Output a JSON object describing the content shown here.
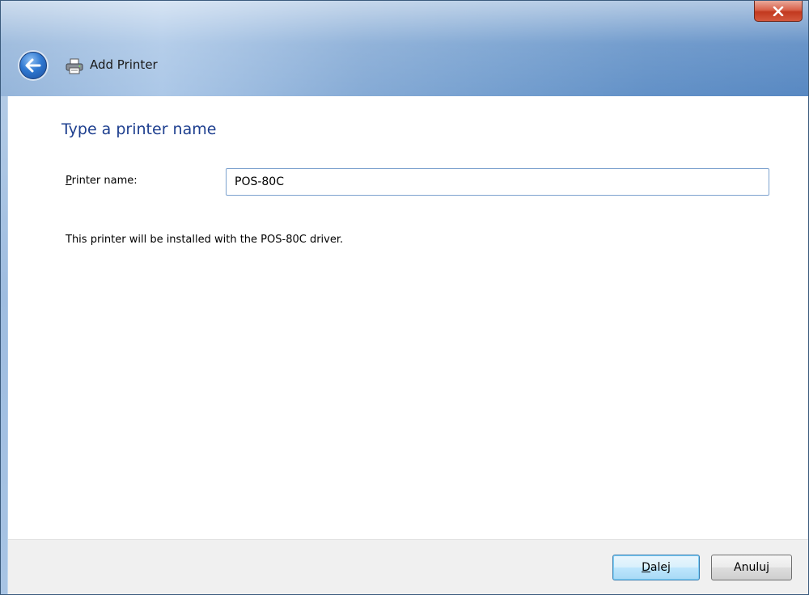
{
  "window": {
    "title": "Add Printer",
    "close_icon": "close-icon",
    "back_icon": "back-arrow-icon",
    "title_icon": "printer-icon"
  },
  "page": {
    "heading": "Type a printer name",
    "printer_name_label": "Printer name:",
    "printer_name_value": "POS-80C",
    "info_text": "This printer will be installed with the POS-80C driver."
  },
  "buttons": {
    "next": "Dalej",
    "cancel": "Anuluj"
  },
  "colors": {
    "heading": "#1e3f8f",
    "close_button": "#c2391f",
    "default_button_border": "#3c7fb1"
  }
}
